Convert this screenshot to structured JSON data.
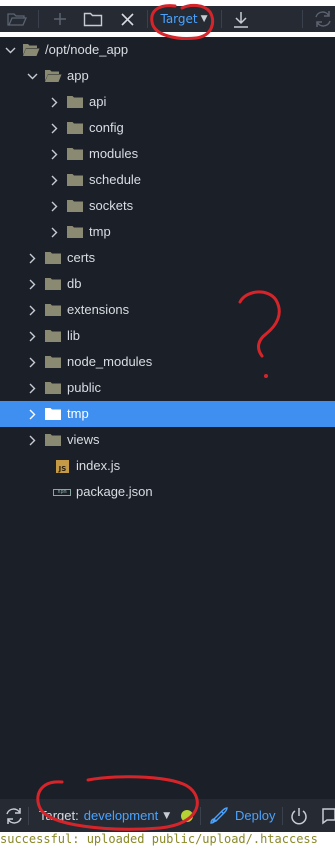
{
  "toolbar": {
    "target_label": "Target"
  },
  "tree": {
    "items": [
      {
        "label": "/opt/node_app",
        "type": "folder-open",
        "depth": 0,
        "expanded": true
      },
      {
        "label": "app",
        "type": "folder-open",
        "depth": 1,
        "expanded": true
      },
      {
        "label": "api",
        "type": "folder",
        "depth": 2,
        "expanded": false
      },
      {
        "label": "config",
        "type": "folder",
        "depth": 2,
        "expanded": false
      },
      {
        "label": "modules",
        "type": "folder",
        "depth": 2,
        "expanded": false
      },
      {
        "label": "schedule",
        "type": "folder",
        "depth": 2,
        "expanded": false
      },
      {
        "label": "sockets",
        "type": "folder",
        "depth": 2,
        "expanded": false
      },
      {
        "label": "tmp",
        "type": "folder",
        "depth": 2,
        "expanded": false
      },
      {
        "label": "certs",
        "type": "folder",
        "depth": 1,
        "expanded": false
      },
      {
        "label": "db",
        "type": "folder",
        "depth": 1,
        "expanded": false
      },
      {
        "label": "extensions",
        "type": "folder",
        "depth": 1,
        "expanded": false
      },
      {
        "label": "lib",
        "type": "folder",
        "depth": 1,
        "expanded": false
      },
      {
        "label": "node_modules",
        "type": "folder",
        "depth": 1,
        "expanded": false
      },
      {
        "label": "public",
        "type": "folder",
        "depth": 1,
        "expanded": false
      },
      {
        "label": "tmp",
        "type": "folder",
        "depth": 1,
        "expanded": false,
        "selected": true
      },
      {
        "label": "views",
        "type": "folder",
        "depth": 1,
        "expanded": false
      },
      {
        "label": "index.js",
        "type": "file-js",
        "depth": 1
      },
      {
        "label": "package.json",
        "type": "file-npm",
        "depth": 1
      }
    ]
  },
  "statusbar": {
    "target_prefix": "Target:",
    "target_value": "development",
    "deploy_label": "Deploy"
  },
  "log": {
    "text": "successful: uploaded public/upload/.htaccess"
  },
  "annotation": {
    "question_mark": "?"
  },
  "colors": {
    "tree_bg": "#1b1f27",
    "toolbar_bg": "#252a33",
    "accent": "#4aa3ff",
    "selected_row": "#3f8ff0",
    "folder": "#8a8a72",
    "status_dot": "#b5d334",
    "annotation_red": "#d6252a"
  }
}
